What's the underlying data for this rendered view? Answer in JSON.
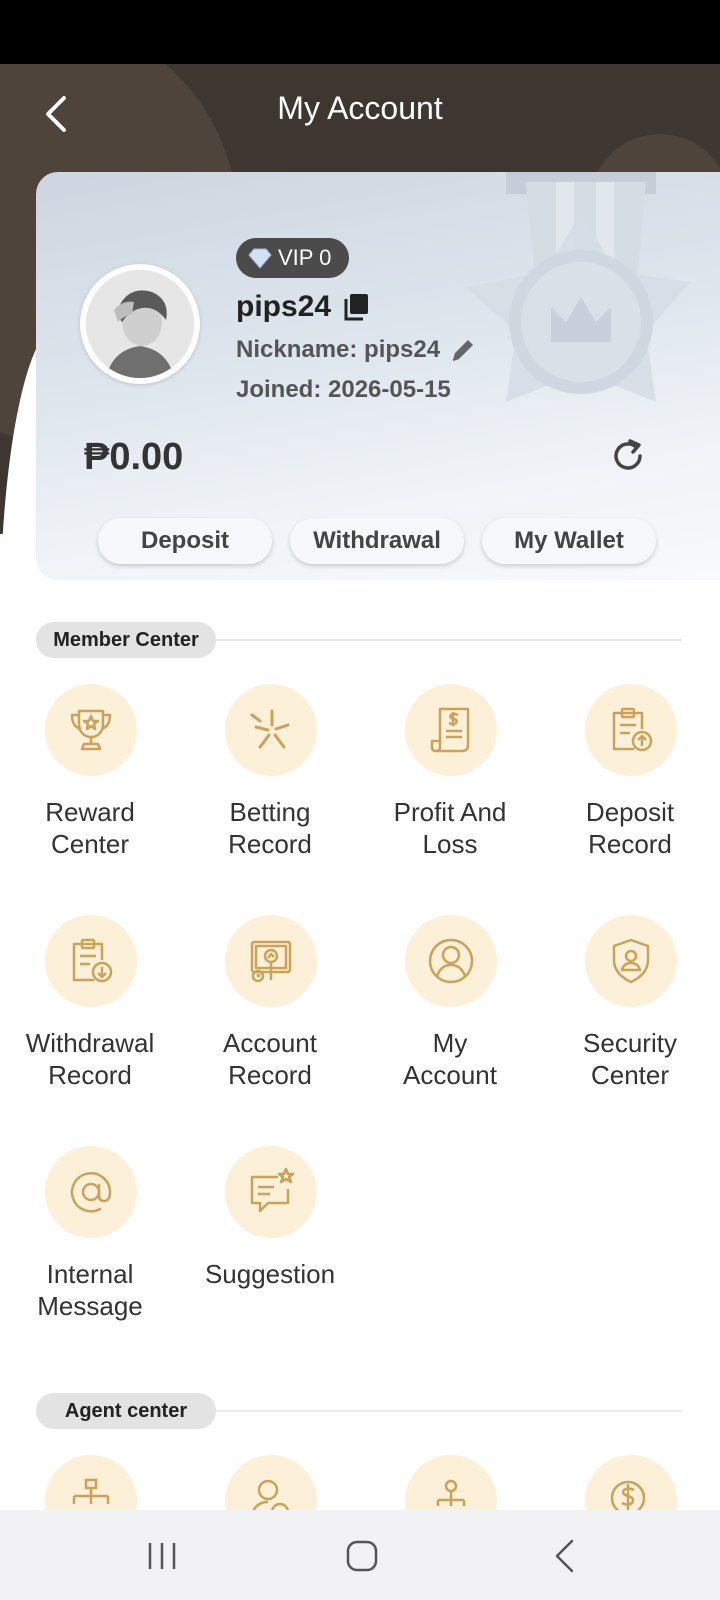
{
  "header": {
    "title": "My Account"
  },
  "profile": {
    "vip_level": "VIP 0",
    "username": "pips24",
    "nickname": "Nickname: pips24",
    "joined": "Joined: 2026-05-15",
    "balance": "₱0.00"
  },
  "actions": {
    "deposit": "Deposit",
    "withdrawal": "Withdrawal",
    "wallet": "My Wallet"
  },
  "member_center": {
    "title": "Member Center",
    "items": [
      {
        "label": "Reward\nCenter",
        "icon": "trophy-icon"
      },
      {
        "label": "Betting\nRecord",
        "icon": "sparkle-icon"
      },
      {
        "label": "Profit And\nLoss",
        "icon": "receipt-dollar-icon"
      },
      {
        "label": "Deposit\nRecord",
        "icon": "clipboard-upload-icon"
      },
      {
        "label": "Withdrawal\nRecord",
        "icon": "clipboard-download-icon"
      },
      {
        "label": "Account\nRecord",
        "icon": "monitor-chart-icon"
      },
      {
        "label": "My\nAccount",
        "icon": "user-circle-icon"
      },
      {
        "label": "Security\nCenter",
        "icon": "shield-user-icon"
      },
      {
        "label": "Internal\nMessage",
        "icon": "at-sign-icon"
      },
      {
        "label": "Suggestion",
        "icon": "chat-star-icon"
      }
    ]
  },
  "agent_center": {
    "title": "Agent center",
    "items": [
      {
        "icon": "org-chart-icon"
      },
      {
        "icon": "user-clock-icon"
      },
      {
        "icon": "network-icon"
      },
      {
        "icon": "dollar-gear-icon"
      }
    ]
  },
  "colors": {
    "accent_icon": "#c9a35a",
    "icon_bg": "#fdf0d8",
    "header_bg": "#3d3631"
  }
}
